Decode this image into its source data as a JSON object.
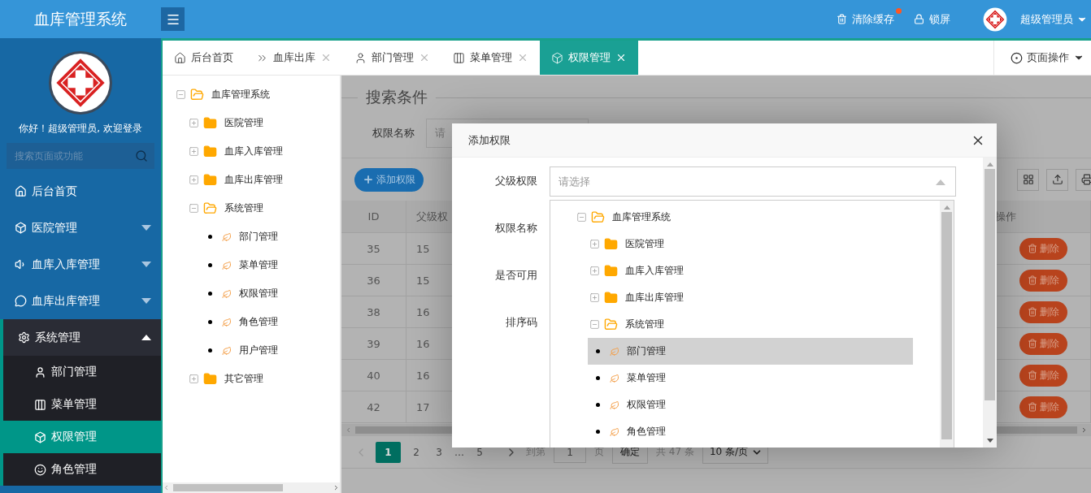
{
  "header": {
    "title": "血库管理系统",
    "actions": [
      {
        "label": "清除缓存",
        "badge": true
      },
      {
        "label": "锁屏",
        "badge": false
      }
    ],
    "user": "超级管理员"
  },
  "sidebar": {
    "greeting": "你好！超级管理员, 欢迎登录",
    "search_placeholder": "搜索页面或功能",
    "items": [
      {
        "label": "后台首页",
        "selected": false
      },
      {
        "label": "医院管理",
        "selected": false,
        "expanded": false
      },
      {
        "label": "血库入库管理",
        "selected": false,
        "expanded": false
      },
      {
        "label": "血库出库管理",
        "selected": false,
        "expanded": false
      },
      {
        "label": "系统管理",
        "selected": false,
        "expanded": true,
        "children": [
          {
            "label": "部门管理",
            "selected": false
          },
          {
            "label": "菜单管理",
            "selected": false
          },
          {
            "label": "权限管理",
            "selected": true
          },
          {
            "label": "角色管理",
            "selected": false
          }
        ]
      }
    ]
  },
  "tabs": [
    {
      "label": "后台首页",
      "closable": false,
      "selected": false
    },
    {
      "label": "血库出库",
      "closable": true,
      "selected": false
    },
    {
      "label": "部门管理",
      "closable": true,
      "selected": false
    },
    {
      "label": "菜单管理",
      "closable": true,
      "selected": false
    },
    {
      "label": "权限管理",
      "closable": true,
      "selected": true
    }
  ],
  "page_actions": "页面操作",
  "tree": [
    {
      "label": "血库管理系统",
      "kind": "folder",
      "expanded": true,
      "children": [
        {
          "label": "医院管理",
          "kind": "folder",
          "expanded": false
        },
        {
          "label": "血库入库管理",
          "kind": "folder",
          "expanded": false
        },
        {
          "label": "血库出库管理",
          "kind": "folder",
          "expanded": false
        },
        {
          "label": "系统管理",
          "kind": "folder",
          "expanded": true,
          "children": [
            {
              "label": "部门管理",
              "kind": "leaf"
            },
            {
              "label": "菜单管理",
              "kind": "leaf"
            },
            {
              "label": "权限管理",
              "kind": "leaf"
            },
            {
              "label": "角色管理",
              "kind": "leaf"
            },
            {
              "label": "用户管理",
              "kind": "leaf"
            }
          ]
        },
        {
          "label": "其它管理",
          "kind": "folder",
          "expanded": false
        }
      ]
    }
  ],
  "search": {
    "legend": "搜索条件",
    "label": "权限名称",
    "placeholder": "请"
  },
  "add_button": "添加权限",
  "table": {
    "columns": [
      "ID",
      "父级权",
      "操作"
    ],
    "rows": [
      {
        "id": "35",
        "parent": "15",
        "action": "删除"
      },
      {
        "id": "36",
        "parent": "15",
        "action": "删除"
      },
      {
        "id": "38",
        "parent": "16",
        "action": "删除"
      },
      {
        "id": "39",
        "parent": "16",
        "action": "删除"
      },
      {
        "id": "40",
        "parent": "16",
        "action": "删除"
      },
      {
        "id": "42",
        "parent": "17",
        "action": "删除"
      }
    ]
  },
  "pagination": {
    "items": [
      {
        "label": "1",
        "kind": "page",
        "selected": true
      },
      {
        "label": "2",
        "kind": "page",
        "selected": false
      },
      {
        "label": "3",
        "kind": "page",
        "selected": false
      },
      {
        "label": "…",
        "kind": "ellipsis"
      },
      {
        "label": "5",
        "kind": "page",
        "selected": false
      }
    ],
    "goto_label": "到第",
    "goto_value": "1",
    "page_unit": "页",
    "confirm": "确定",
    "total": "共 47 条",
    "page_size": "10 条/页"
  },
  "modal": {
    "title": "添加权限",
    "fields": [
      "父级权限",
      "权限名称",
      "是否可用",
      "排序码"
    ],
    "select_placeholder": "请选择",
    "dropdown_tree": [
      {
        "label": "血库管理系统",
        "kind": "folder",
        "expanded": true,
        "children": [
          {
            "label": "医院管理",
            "kind": "folder",
            "expanded": false
          },
          {
            "label": "血库入库管理",
            "kind": "folder",
            "expanded": false
          },
          {
            "label": "血库出库管理",
            "kind": "folder",
            "expanded": false
          },
          {
            "label": "系统管理",
            "kind": "folder",
            "expanded": true,
            "children": [
              {
                "label": "部门管理",
                "kind": "leaf",
                "selected": true
              },
              {
                "label": "菜单管理",
                "kind": "leaf",
                "selected": false
              },
              {
                "label": "权限管理",
                "kind": "leaf",
                "selected": false
              },
              {
                "label": "角色管理",
                "kind": "leaf",
                "selected": false
              }
            ]
          }
        ]
      }
    ]
  }
}
